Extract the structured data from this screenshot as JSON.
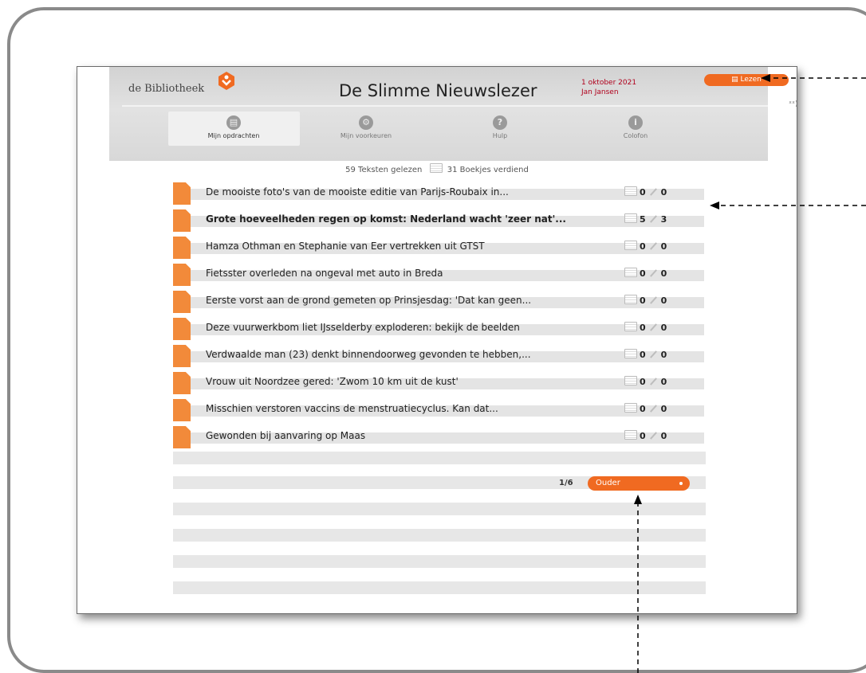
{
  "app": {
    "logo": "de Bibliotheek",
    "title": "De Slimme Nieuwslezer",
    "date": "1 oktober 2021",
    "user": "Jan Jansen",
    "read_button": "Lezen",
    "speaker_icon": "speaker-icon"
  },
  "nav": [
    {
      "label": "Mijn opdrachten",
      "icon": "book-icon"
    },
    {
      "label": "Mijn voorkeuren",
      "icon": "gear-icon"
    },
    {
      "label": "Hulp",
      "icon": "question-icon"
    },
    {
      "label": "Colofon",
      "icon": "info-icon"
    }
  ],
  "summary": {
    "read": "59 Teksten gelezen",
    "earned": "31 Boekjes verdiend"
  },
  "articles": [
    {
      "title": "De mooiste foto's van de mooiste editie van Parijs-Roubaix in...",
      "books": "0",
      "notes": "0"
    },
    {
      "title": "Grote hoeveelheden regen op komst: Nederland wacht 'zeer nat'...",
      "books": "5",
      "notes": "3",
      "bold": true
    },
    {
      "title": "Hamza Othman en Stephanie van Eer vertrekken uit GTST",
      "books": "0",
      "notes": "0"
    },
    {
      "title": "Fietsster overleden na ongeval met auto in Breda",
      "books": "0",
      "notes": "0"
    },
    {
      "title": "Eerste vorst aan de grond gemeten op Prinsjesdag: 'Dat kan geen...",
      "books": "0",
      "notes": "0"
    },
    {
      "title": "Deze vuurwerkbom liet IJsselderby exploderen: bekijk de beelden",
      "books": "0",
      "notes": "0"
    },
    {
      "title": "Verdwaalde man (23) denkt binnendoorweg gevonden te hebben,...",
      "books": "0",
      "notes": "0"
    },
    {
      "title": "Vrouw uit Noordzee gered: 'Zwom 10 km uit de kust'",
      "books": "0",
      "notes": "0"
    },
    {
      "title": "Misschien verstoren vaccins de menstruatiecyclus. Kan dat...",
      "books": "0",
      "notes": "0"
    },
    {
      "title": "Gewonden bij aanvaring op Maas",
      "books": "0",
      "notes": "0"
    }
  ],
  "pagination": {
    "page": "1/6",
    "older_button": "Ouder"
  },
  "colors": {
    "accent": "#f06a21",
    "date_red": "#b0001c"
  }
}
